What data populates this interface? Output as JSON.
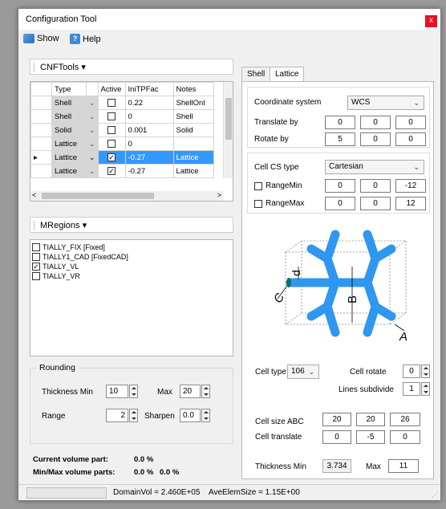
{
  "window": {
    "title": "Configuration Tool",
    "close": "x"
  },
  "menu": {
    "show": "Show",
    "help": "Help",
    "help_icon": "?"
  },
  "cnftools": {
    "header": "CNFTools ▾",
    "columns": [
      "Type",
      "Active",
      "IniTPFac",
      "Notes"
    ],
    "rows": [
      {
        "type": "Shell",
        "active": false,
        "initpfac": "0.22",
        "notes": "ShellOnl"
      },
      {
        "type": "Shell",
        "active": false,
        "initpfac": "0",
        "notes": "Shell"
      },
      {
        "type": "Solid",
        "active": false,
        "initpfac": "0.001",
        "notes": "Solid"
      },
      {
        "type": "Lattice",
        "active": false,
        "initpfac": "0",
        "notes": ""
      },
      {
        "type": "Lattice",
        "active": true,
        "initpfac": "-0.27",
        "notes": "Lattice",
        "selected": true
      },
      {
        "type": "Lattice",
        "active": true,
        "initpfac": "-0.27",
        "notes": "Lattice"
      }
    ]
  },
  "mregions": {
    "header": "MRegions ▾",
    "items": [
      {
        "label": "TIALLY_FIX [Fixed]",
        "checked": false
      },
      {
        "label": "TIALLY1_CAD [FixedCAD]",
        "checked": false
      },
      {
        "label": "TIALLY_VL",
        "checked": true
      },
      {
        "label": "TIALLY_VR",
        "checked": false
      }
    ]
  },
  "rounding": {
    "title": "Rounding",
    "thickness_min_label": "Thickness Min",
    "thickness_min": "10",
    "max_label": "Max",
    "max": "20",
    "range_label": "Range",
    "range": "2",
    "sharpen_label": "Sharpen",
    "sharpen": "0.0"
  },
  "volume": {
    "current_label": "Current volume part:",
    "current": "0.0 %",
    "minmax_label": "Min/Max volume parts:",
    "min": "0.0 %",
    "max": "0.0 %"
  },
  "tabs": {
    "shell": "Shell",
    "lattice": "Lattice"
  },
  "lattice": {
    "coord_label": "Coordinate system",
    "coord_value": "WCS",
    "translate_label": "Translate by",
    "translate": [
      "0",
      "0",
      "0"
    ],
    "rotate_label": "Rotate by",
    "rotate": [
      "5",
      "0",
      "0"
    ],
    "cellcs_label": "Cell CS type",
    "cellcs_value": "Cartesian",
    "rangemin_label": "RangeMin",
    "rangemin": [
      "0",
      "0",
      "-12"
    ],
    "rangemax_label": "RangeMax",
    "rangemax": [
      "0",
      "0",
      "12"
    ],
    "diagram_labels": {
      "d": "d",
      "b": "B",
      "c": "C",
      "a": "A"
    },
    "celltype_label": "Cell type",
    "celltype_value": "106",
    "cellrotate_label": "Cell rotate",
    "cellrotate": "0",
    "lines_label": "Lines subdivide",
    "lines": "1",
    "cellsize_label": "Cell size ABC",
    "cellsize": [
      "20",
      "20",
      "26"
    ],
    "celltranslate_label": "Cell translate",
    "celltranslate": [
      "0",
      "-5",
      "0"
    ],
    "thickmin_label": "Thickness Min",
    "thickmin": "3.734",
    "thickmax_label": "Max",
    "thickmax": "11"
  },
  "status": {
    "domainvol": "DomainVol = 2.460E+05",
    "aveelem": "AveElemSize = 1.15E+00"
  },
  "colors": {
    "selection": "#3399ff",
    "lattice_blue": "#2f97ef",
    "close_red": "#e81123"
  }
}
